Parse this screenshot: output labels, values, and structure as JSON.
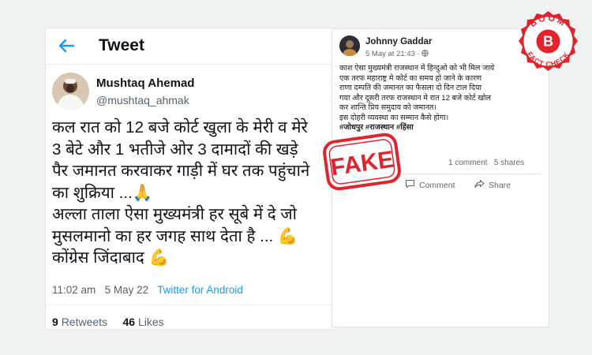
{
  "tweet": {
    "header_title": "Tweet",
    "author_name": "Mushtaq Ahemad",
    "author_handle": "@mushtaq_ahmak",
    "body_lines": [
      "कल रात को 12 बजे कोर्ट खुला के मेरी व मेरे",
      "3 बेटे और 1 भतीजे ओर 3 दामादों की खड़े",
      "पैर जमानत करवाकर गाड़ी में घर तक पहुंचाने",
      "का शुक्रिया ...🙏",
      "अल्ला ताला ऐसा मुख्यमंत्री हर सूबे में दे जो",
      "मुसलमानो का हर जगह साथ देता है ... 💪",
      "कोंग्रेस जिंदाबाद 💪"
    ],
    "time": "11:02 am",
    "date": "5 May 22",
    "source": "Twitter for Android",
    "retweets_count": "9",
    "retweets_label": "Retweets",
    "likes_count": "46",
    "likes_label": "Likes"
  },
  "facebook": {
    "author_name": "Johnny Gaddar",
    "timestamp": "5 May at 21:43 · ",
    "body_lines": [
      "काश ऐसा मुख्यमंत्री राजस्थान में हिन्दुओ को भी मिल जाये",
      "एक तरफ महाराष्ट्र मे कोर्ट का समय हो जाने के कारण",
      "राणा दम्पति की जमानत का फैसला दो दिन टाल दिया",
      "गया और दूसरी तरफ राजस्थान मे रात 12 बजे कोर्ट खोल",
      "कर शान्ति प्रिय समुदाय को जमानत।",
      "इस दोहरी व्यवस्था का सम्मान कैसे होगा।"
    ],
    "hashtags": "#जोधपुर #राजस्थान #हिंसा",
    "comments": "1 comment",
    "shares": "5 shares",
    "comment_label": "Comment",
    "share_label": "Share"
  },
  "stamp": {
    "text": "FAKE",
    "color": "#e0242b"
  },
  "badge": {
    "top_text": "BOOM",
    "letter": "B",
    "bottom_text": "FACT CHECK",
    "color": "#e0242b"
  },
  "colors": {
    "twitter_blue": "#1d9bf0",
    "page_bg": "#f1f3f3"
  }
}
